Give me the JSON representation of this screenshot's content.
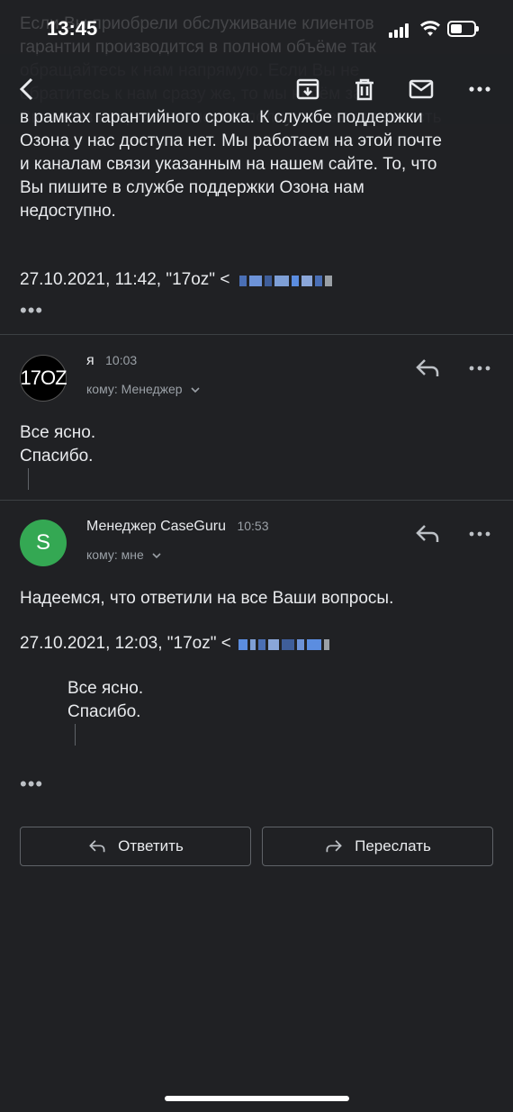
{
  "status": {
    "time": "13:45"
  },
  "background_text": "Если Вы приобрели обслуживание клиентов\nгарантии производится в полном объёме так\nобращайтесь к нам напрямую. Если Вы не\nобратитесь к нам сразу же, то мы несём за\nВы через нас, так мы несём полную ответственность",
  "quoted": {
    "text": "в рамках гарантийного срока. К службе поддержки\nОзона у нас доступа нет. Мы работаем на этой почте\nи каналам связи указанным на нашем сайте. То, что\nВы пишите в службе поддержки Озона нам\nнедоступно.",
    "header": "27.10.2021, 11:42, \"17oz\" <"
  },
  "messages": [
    {
      "avatar_text": "17OZ",
      "sender": "я",
      "time": "10:03",
      "recipient": "кому: Менеджер",
      "body": "Все ясно.\nСпасибо."
    },
    {
      "avatar_text": "S",
      "sender": "Менеджер CaseGuru",
      "time": "10:53",
      "recipient": "кому: мне",
      "body": "Надеемся, что ответили на все Ваши вопросы.",
      "quote_header": "27.10.2021, 12:03, \"17oz\" <",
      "quote_body": "Все ясно.\nСпасибо."
    }
  ],
  "actions": {
    "reply": "Ответить",
    "forward": "Переслать"
  },
  "colors": {
    "background": "#202124",
    "avatar_green": "#34a853",
    "blur_blue": "#5b8de0"
  },
  "icons": [
    "back-icon",
    "archive-icon",
    "trash-icon",
    "mail-icon",
    "more-icon",
    "reply-icon",
    "forward-icon"
  ]
}
